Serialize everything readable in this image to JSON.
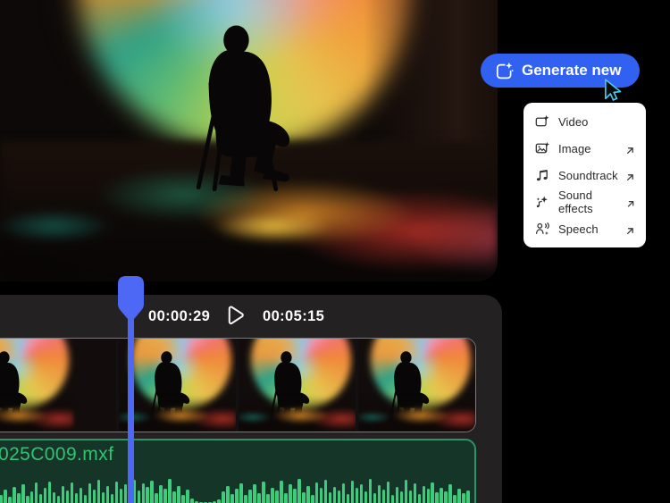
{
  "colors": {
    "accent_blue": "#3161f1",
    "playhead_blue": "#4d68f4",
    "waveform_green": "#3ecb7c",
    "filename_green": "#2fc472",
    "panel_bg": "#242122",
    "track_bg": "#143527",
    "menu_bg": "#ffffff"
  },
  "generate_button": {
    "label": "Generate new",
    "icon": "generate-sparkle-icon"
  },
  "cursor": {
    "icon": "pointer-cursor",
    "outline_color": "#49c9ef"
  },
  "menu": {
    "items": [
      {
        "label": "Video",
        "icon": "video-generate-icon",
        "external": false
      },
      {
        "label": "Image",
        "icon": "image-generate-icon",
        "external": true
      },
      {
        "label": "Soundtrack",
        "icon": "soundtrack-icon",
        "external": true
      },
      {
        "label": "Sound effects",
        "icon": "sound-effects-icon",
        "external": true
      },
      {
        "label": "Speech",
        "icon": "speech-icon",
        "external": true
      }
    ],
    "external_arrow_icon": "arrow-up-right-icon"
  },
  "timeline": {
    "current_time": "00:00:29",
    "total_time": "00:05:15",
    "play_icon": "play-icon",
    "video_track": {
      "thumbnail_count": 5
    },
    "audio_track": {
      "filename": "025C009.mxf",
      "waveform_heights": [
        9,
        15,
        7,
        18,
        11,
        21,
        8,
        13,
        23,
        10,
        17,
        24,
        12,
        8,
        19,
        14,
        23,
        11,
        17,
        9,
        22,
        15,
        26,
        12,
        19,
        10,
        24,
        16,
        21,
        11,
        26,
        14,
        22,
        18,
        25,
        11,
        20,
        16,
        27,
        13,
        19,
        9,
        15,
        5,
        2,
        1,
        1,
        1,
        2,
        4,
        13,
        19,
        10,
        16,
        22,
        9,
        15,
        21,
        11,
        24,
        10,
        17,
        14,
        25,
        11,
        21,
        16,
        27,
        12,
        19,
        9,
        23,
        17,
        26,
        12,
        18,
        14,
        22,
        10,
        25,
        17,
        21,
        13,
        27,
        11,
        20,
        15,
        24,
        9,
        18,
        13,
        26,
        14,
        22,
        10,
        19,
        16,
        23,
        12,
        17,
        13,
        21,
        9,
        16,
        11,
        14
      ]
    }
  }
}
